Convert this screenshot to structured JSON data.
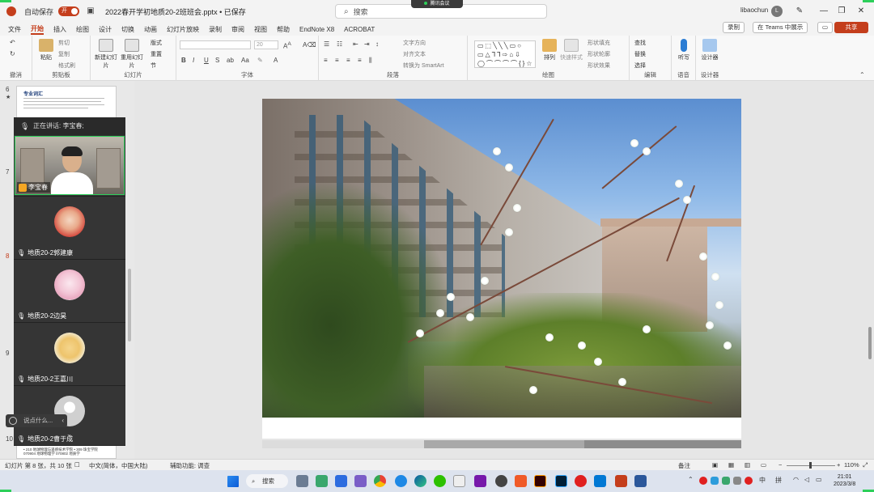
{
  "titlebar": {
    "autosave_label": "自动保存",
    "autosave_toggle": "开",
    "filename": "2022春开学初地质20-2班班会.pptx • 已保存",
    "search_placeholder": "搜索",
    "meeting_pill": "腾讯会议",
    "username": "libaochun",
    "avatar_letter": "L"
  },
  "menu": {
    "items": [
      "文件",
      "开始",
      "插入",
      "绘图",
      "设计",
      "切换",
      "动画",
      "幻灯片放映",
      "录制",
      "审阅",
      "视图",
      "帮助",
      "EndNote X8",
      "ACROBAT"
    ],
    "active": "开始",
    "record_label": "录制",
    "teams_label": "在 Teams 中展示",
    "share_label": "共享"
  },
  "ribbon": {
    "undo_group": "撤消",
    "clipboard_group": "剪贴板",
    "paste_label": "粘贴",
    "cut_label": "剪切",
    "copy_label": "复制",
    "format_painter_label": "格式刷",
    "slides_group": "幻灯片",
    "new_slide_label": "新建幻灯片",
    "reuse_slide_label": "重用幻灯片",
    "layout_label": "版式",
    "reset_label": "重置",
    "section_label": "节",
    "font_group": "字体",
    "font_size": "20",
    "paragraph_group": "段落",
    "text_direction_label": "文字方向",
    "align_text_label": "对齐文本",
    "smartart_label": "转换为 SmartArt",
    "drawing_group": "绘图",
    "arrange_label": "排列",
    "quick_styles_label": "快速样式",
    "shape_fill_label": "形状填充",
    "shape_outline_label": "形状轮廓",
    "shape_effects_label": "形状效果",
    "editing_group": "编辑",
    "find_label": "查找",
    "replace_label": "替换",
    "select_label": "选择",
    "voice_group": "语音",
    "dictate_label": "听写",
    "designer_group": "设计器",
    "designer_label": "设计器"
  },
  "thumbnails": {
    "slide6_title": "专业词汇",
    "numbers": [
      "6",
      "7",
      "8",
      "9",
      "10"
    ],
    "current": "8",
    "bottom_thumb_text": "• 210 地球物理与遥感技术学院 • 309 珠宝学院 070904 地球物理学 070802 地质学"
  },
  "meeting": {
    "speaking_label": "正在讲话: 李宝春;",
    "participants": [
      {
        "name": "李宝春",
        "video": true
      },
      {
        "name": "地质20-2郭建康"
      },
      {
        "name": "地质20-2边昊"
      },
      {
        "name": "地质20-2王嘉川"
      },
      {
        "name": "地质20-2曹于成"
      }
    ],
    "chat_placeholder": "说点什么..."
  },
  "statusbar": {
    "slide_info": "幻灯片 第 8 张，共 10 张",
    "language": "中文(简体，中国大陆)",
    "accessibility": "辅助功能: 调查",
    "notes_label": "备注",
    "zoom": "110%"
  },
  "taskbar": {
    "search_label": "搜索",
    "ime_mode": "中",
    "ime_input": "拼",
    "time": "21:01",
    "date": "2023/3/8"
  }
}
